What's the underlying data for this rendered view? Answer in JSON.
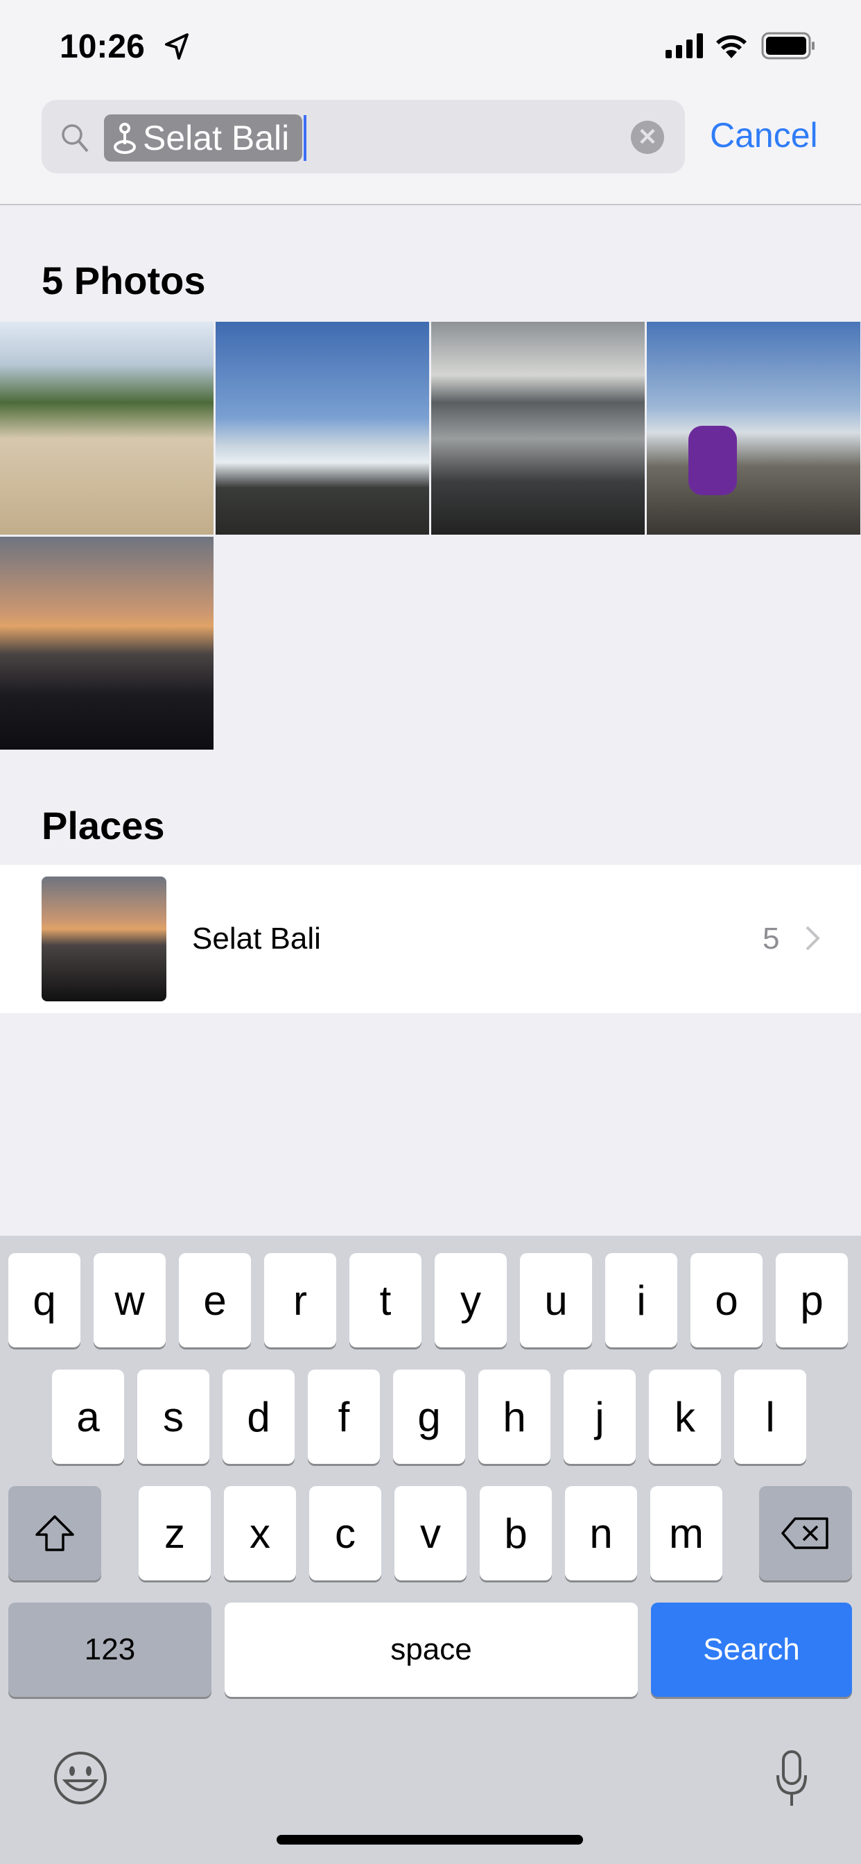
{
  "status_bar": {
    "time": "10:26",
    "icons": [
      "location-arrow-icon",
      "cellular-signal-icon",
      "wifi-icon",
      "battery-icon"
    ]
  },
  "search": {
    "token": "Selat Bali",
    "token_icon": "location-pin-icon",
    "cancel": "Cancel"
  },
  "photos": {
    "title": "5 Photos",
    "count": 5
  },
  "places": {
    "title": "Places",
    "items": [
      {
        "name": "Selat Bali",
        "count": "5"
      }
    ]
  },
  "keyboard": {
    "row1": [
      "q",
      "w",
      "e",
      "r",
      "t",
      "y",
      "u",
      "i",
      "o",
      "p"
    ],
    "row2": [
      "a",
      "s",
      "d",
      "f",
      "g",
      "h",
      "j",
      "k",
      "l"
    ],
    "row3": [
      "z",
      "x",
      "c",
      "v",
      "b",
      "n",
      "m"
    ],
    "numbers": "123",
    "space": "space",
    "search": "Search",
    "accent": "#2f7cf6"
  }
}
